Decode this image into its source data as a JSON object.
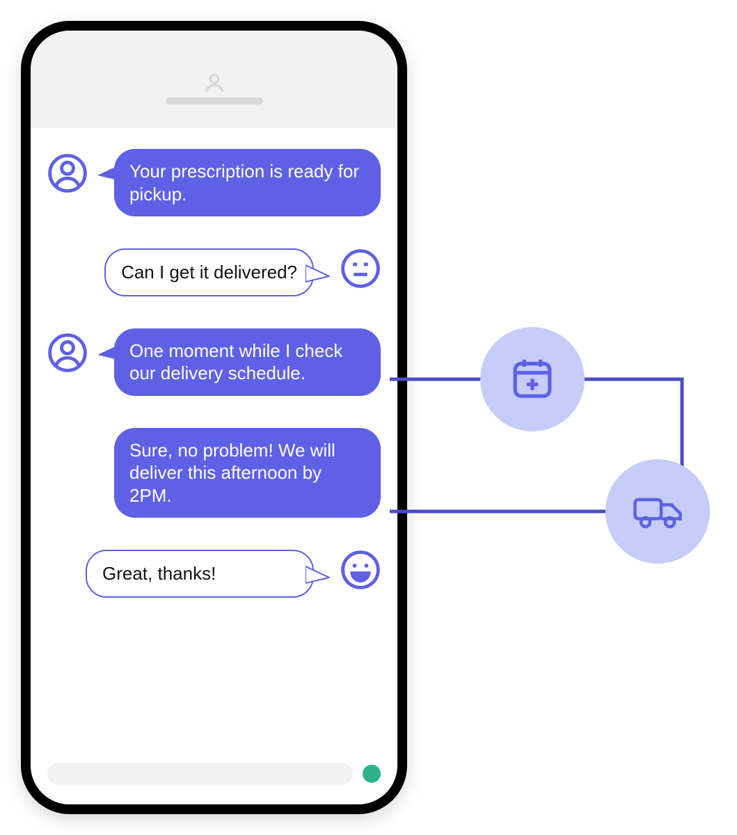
{
  "colors": {
    "accent": "#5E60E6",
    "accent_light": "#C5CCF8",
    "phone_black": "#000000"
  },
  "chat": {
    "messages": [
      {
        "from": "agent",
        "text": "Your prescription is ready for pickup."
      },
      {
        "from": "user",
        "text": "Can I get it delivered?",
        "emotion": "neutral-face"
      },
      {
        "from": "agent",
        "text": "One moment while I check our delivery schedule."
      },
      {
        "from": "agent",
        "text": "Sure, no problem! We will deliver this afternoon by 2PM.",
        "continuation": true
      },
      {
        "from": "user",
        "text": "Great, thanks!",
        "emotion": "happy-face"
      }
    ]
  },
  "diagram": {
    "nodes": [
      {
        "icon": "calendar-plus",
        "name": "schedule"
      },
      {
        "icon": "delivery-truck",
        "name": "delivery"
      }
    ]
  }
}
